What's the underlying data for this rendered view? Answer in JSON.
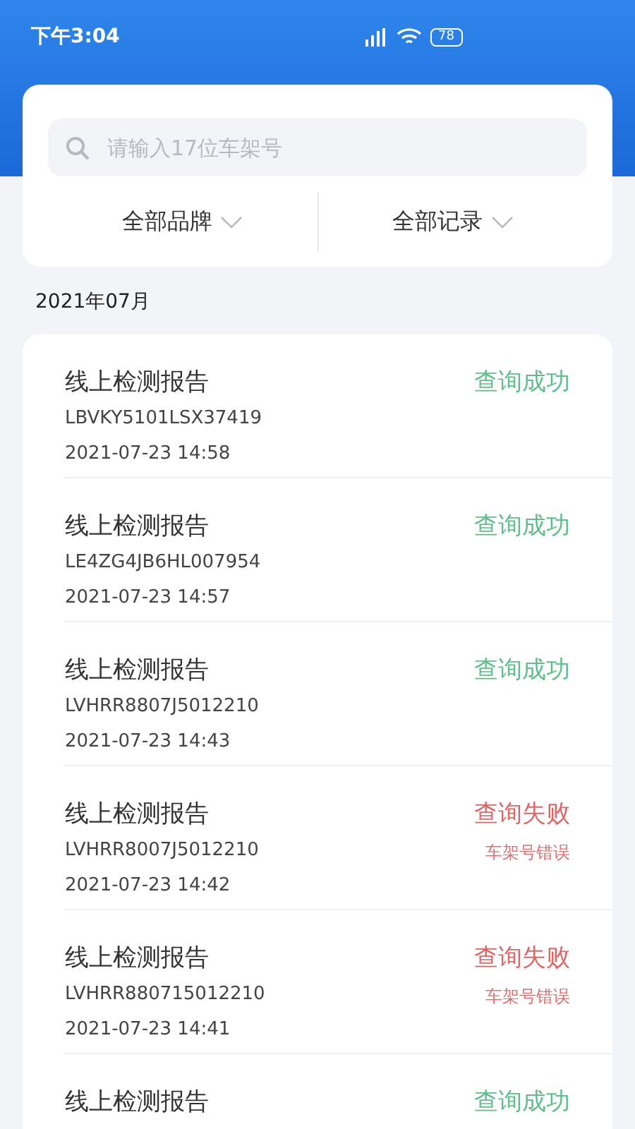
{
  "status_bar": {
    "time": "下午3:04",
    "battery": "78"
  },
  "search": {
    "placeholder": "请输入17位车架号"
  },
  "filters": [
    {
      "label": "全部品牌"
    },
    {
      "label": "全部记录"
    }
  ],
  "month": "2021年07月",
  "records": [
    {
      "title": "线上检测报告",
      "vin": "LBVKY5101LSX37419",
      "time": "2021-07-23 14:58",
      "kind": "success",
      "status": "查询成功"
    },
    {
      "title": "线上检测报告",
      "vin": "LE4ZG4JB6HL007954",
      "time": "2021-07-23 14:57",
      "kind": "success",
      "status": "查询成功"
    },
    {
      "title": "线上检测报告",
      "vin": "LVHRR8807J5012210",
      "time": "2021-07-23 14:43",
      "kind": "success",
      "status": "查询成功"
    },
    {
      "title": "线上检测报告",
      "vin": "LVHRR8007J5012210",
      "time": "2021-07-23 14:42",
      "kind": "failure",
      "status": "查询失败",
      "reason": "车架号错误"
    },
    {
      "title": "线上检测报告",
      "vin": "LVHRR880715012210",
      "time": "2021-07-23 14:41",
      "kind": "failure",
      "status": "查询失败",
      "reason": "车架号错误"
    },
    {
      "title": "线上检测报告",
      "kind": "success",
      "status": "查询成功"
    }
  ]
}
